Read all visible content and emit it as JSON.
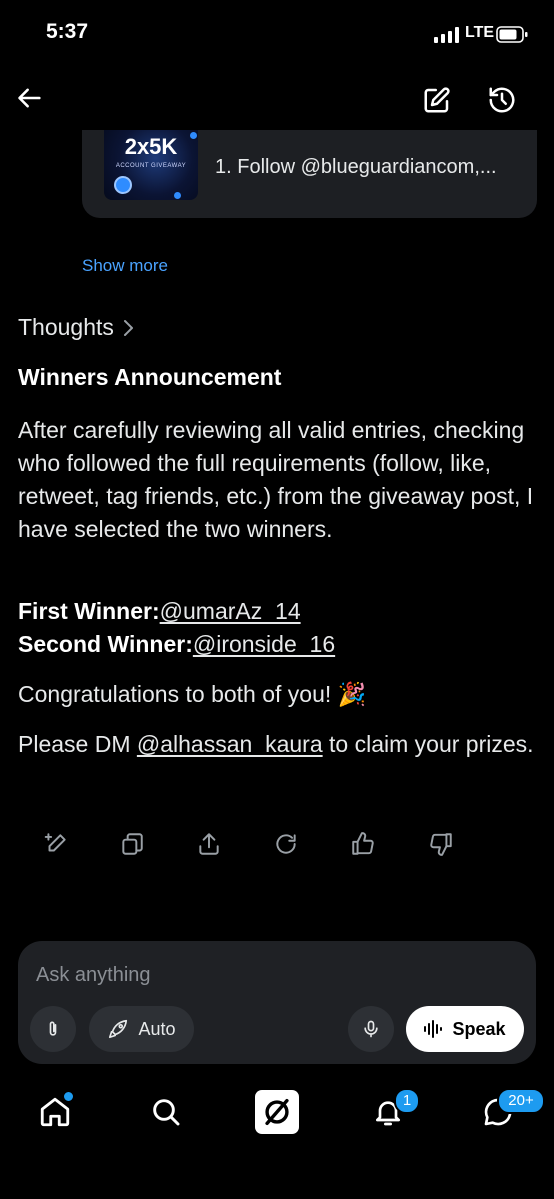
{
  "status_bar": {
    "time": "5:37",
    "network": "LTE"
  },
  "attachment": {
    "thumbnail_title": "2x5K",
    "thumbnail_subtitle": "ACCOUNT GIVEAWAY",
    "preview_text": "1. Follow @blueguardiancom,..."
  },
  "show_more": "Show more",
  "thoughts_label": "Thoughts",
  "content": {
    "heading": "Winners Announcement",
    "paragraph": "After carefully reviewing all valid entries, checking who followed the full requirements (follow, like, retweet, tag friends, etc.) from the giveaway post, I have selected the two winners.",
    "first_winner_label": "First Winner:",
    "first_winner_handle": "@umarAz_14",
    "second_winner_label": "Second Winner:",
    "second_winner_handle": "@ironside_16",
    "congrats": "Congratulations to both of you! 🎉",
    "dm_prefix": "Please DM ",
    "dm_handle": "@alhassan_kaura",
    "dm_suffix": " to claim your prizes."
  },
  "composer": {
    "placeholder": "Ask anything",
    "auto_label": "Auto",
    "speak_label": "Speak"
  },
  "nav": {
    "notifications_badge": "1",
    "messages_badge": "20+"
  },
  "colors": {
    "accent": "#1d9bf0",
    "link": "#4aa3ff",
    "background": "#000000"
  }
}
